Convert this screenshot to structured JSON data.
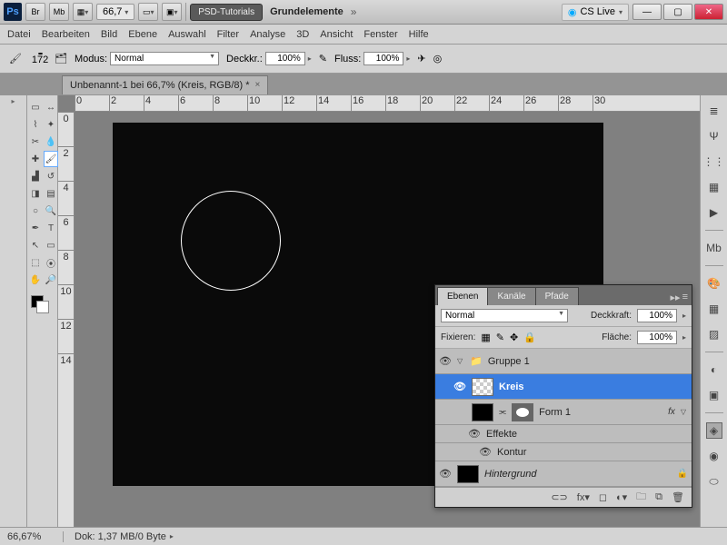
{
  "titlebar": {
    "zoom": "66,7",
    "badge1": "PSD-Tutorials",
    "badge2": "Grundelemente",
    "cslive": "CS Live",
    "icons": {
      "br": "Br",
      "mb": "Mb"
    }
  },
  "menubar": [
    "Datei",
    "Bearbeiten",
    "Bild",
    "Ebene",
    "Auswahl",
    "Filter",
    "Analyse",
    "3D",
    "Ansicht",
    "Fenster",
    "Hilfe"
  ],
  "options": {
    "brush_size": "172",
    "mode_label": "Modus:",
    "mode_value": "Normal",
    "opacity_label": "Deckkr.:",
    "opacity_value": "100%",
    "flow_label": "Fluss:",
    "flow_value": "100%"
  },
  "doctab": {
    "title": "Unbenannt-1 bei 66,7% (Kreis, RGB/8) *"
  },
  "ruler_h": [
    "0",
    "2",
    "4",
    "6",
    "8",
    "10",
    "12",
    "14",
    "16",
    "18",
    "20",
    "22",
    "24",
    "26",
    "28",
    "30"
  ],
  "ruler_v": [
    "0",
    "2",
    "4",
    "6",
    "8",
    "10",
    "12",
    "14"
  ],
  "statusbar": {
    "zoom": "66,67%",
    "dok": "Dok: 1,37 MB/0 Byte"
  },
  "panel": {
    "tabs": [
      "Ebenen",
      "Kanäle",
      "Pfade"
    ],
    "blend_value": "Normal",
    "deckkraft_label": "Deckkraft:",
    "deckkraft_value": "100%",
    "fixieren_label": "Fixieren:",
    "flache_label": "Fläche:",
    "flache_value": "100%",
    "layers": {
      "group": "Gruppe 1",
      "kreis": "Kreis",
      "form": "Form 1",
      "effekte": "Effekte",
      "kontur": "Kontur",
      "hintergrund": "Hintergrund",
      "fx": "fx"
    },
    "footer_link": "⊂⊃"
  }
}
